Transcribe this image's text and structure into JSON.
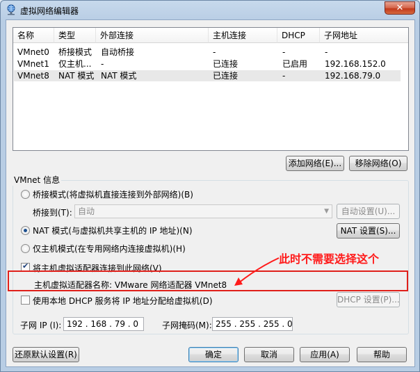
{
  "window": {
    "title": "虚拟网络编辑器",
    "close_label": "✕"
  },
  "netlist": {
    "columns": [
      "名称",
      "类型",
      "外部连接",
      "主机连接",
      "DHCP",
      "子网地址"
    ],
    "rows": [
      [
        "VMnet0",
        "桥接模式",
        "自动桥接",
        "-",
        "-",
        "-"
      ],
      [
        "VMnet1",
        "仅主机...",
        "-",
        "已连接",
        "已启用",
        "192.168.152.0"
      ],
      [
        "VMnet8",
        "NAT 模式",
        "NAT 模式",
        "已连接",
        "-",
        "192.168.79.0"
      ]
    ],
    "selected_row": 2
  },
  "buttons": {
    "add_network": "添加网络(E)...",
    "remove_network": "移除网络(O)",
    "auto_settings": "自动设置(U)...",
    "nat_settings": "NAT 设置(S)...",
    "dhcp_settings": "DHCP 设置(P)...",
    "restore_defaults": "还原默认设置(R)",
    "ok": "确定",
    "cancel": "取消",
    "apply": "应用(A)",
    "help": "帮助"
  },
  "vmnet_info": {
    "title": "VMnet 信息",
    "bridged_label": "桥接模式(将虚拟机直接连接到外部网络)(B)",
    "bridged_to_label": "桥接到(T):",
    "bridged_to_value": "自动",
    "nat_label": "NAT 模式(与虚拟机共享主机的 IP 地址)(N)",
    "host_only_label": "仅主机模式(在专用网络内连接虚拟机)(H)",
    "selected_mode": "nat",
    "connect_adapter_label": "将主机虚拟适配器连接到此网络(V)",
    "connect_adapter_checked": true,
    "adapter_name_label": "主机虚拟适配器名称: VMware 网络适配器 VMnet8",
    "dhcp_label": "使用本地 DHCP 服务将 IP 地址分配给虚拟机(D)",
    "dhcp_checked": false,
    "subnet_ip_label": "子网 IP (I):",
    "subnet_ip_value": "192 . 168 . 79 . 0",
    "subnet_mask_label": "子网掩码(M):",
    "subnet_mask_value": "255 . 255 . 255 . 0"
  },
  "annotation": {
    "text": "此时不需要选择这个",
    "color": "#ff1a1a"
  }
}
